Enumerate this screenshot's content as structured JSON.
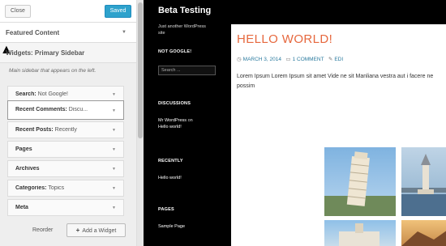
{
  "customizer": {
    "close_label": "Close",
    "saved_label": "Saved",
    "sections": [
      {
        "title": "Featured Content"
      },
      {
        "title": "Widgets: Primary Sidebar"
      }
    ],
    "sidebar_description": "Main sidebar that appears on the left.",
    "widgets": [
      {
        "title": "Search:",
        "subtitle": " Not Google!"
      },
      {
        "title": "Recent Comments:",
        "subtitle": " Discu..."
      },
      {
        "title": "Recent Posts:",
        "subtitle": " Recently"
      },
      {
        "title": "Pages",
        "subtitle": ""
      },
      {
        "title": "Archives",
        "subtitle": ""
      },
      {
        "title": "Categories:",
        "subtitle": " Topics"
      },
      {
        "title": "Meta",
        "subtitle": ""
      }
    ],
    "reorder_label": "Reorder",
    "add_widget_label": "Add a Widget"
  },
  "site": {
    "title": "Beta Testing",
    "tagline": "Just another WordPress site",
    "sidebar": {
      "not_google_heading": "NOT GOOGLE!",
      "search_placeholder": "Search ...",
      "discussions_heading": "DISCUSSIONS",
      "comment_author": "Mr WordPress",
      "comment_on": " on ",
      "comment_post": "Hello world!",
      "recently_heading": "RECENTLY",
      "recent_post": "Hello world!",
      "pages_heading": "PAGES",
      "page_link": "Sample Page"
    },
    "post": {
      "title": "HELLO WORLD!",
      "date": "MARCH 3, 2014",
      "comments": "1 COMMENT",
      "edit": "EDI",
      "body": "Lorem Ipsum Lorem Ipsum sit amet Vide ne sit Manliana vestra aut i facere ne possim"
    }
  }
}
